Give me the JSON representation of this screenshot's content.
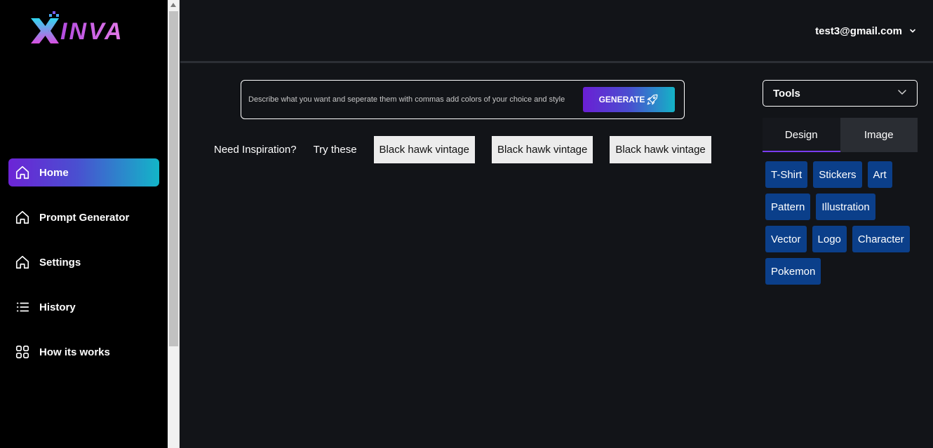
{
  "brand": {
    "logo_text": "INVA",
    "logo_icon": "x-logo-icon"
  },
  "sidebar": {
    "items": [
      {
        "label": "Home",
        "icon": "home-icon",
        "active": true
      },
      {
        "label": "Prompt Generator",
        "icon": "home-icon",
        "active": false
      },
      {
        "label": "Settings",
        "icon": "home-icon",
        "active": false
      },
      {
        "label": "History",
        "icon": "list-icon",
        "active": false
      },
      {
        "label": "How its works",
        "icon": "grid-icon",
        "active": false
      }
    ]
  },
  "header": {
    "user_email": "test3@gmail.com"
  },
  "prompt": {
    "placeholder": "Describe what you want and seperate them with commas add colors of your choice and style",
    "generate_label": "GENERATE"
  },
  "inspiration": {
    "label": "Need Inspiration?",
    "try_label": "Try these",
    "chips": [
      "Black hawk vintage",
      "Black hawk vintage",
      "Black hawk vintage"
    ]
  },
  "panel": {
    "tools_label": "Tools",
    "tabs": [
      {
        "label": "Design",
        "active": true
      },
      {
        "label": "Image",
        "active": false
      }
    ],
    "tags": [
      [
        "T-Shirt",
        "Stickers",
        "Art"
      ],
      [
        "Pattern",
        "Illustration"
      ],
      [
        "Vector",
        "Logo",
        "Character"
      ],
      [
        "Pokemon"
      ]
    ]
  },
  "colors": {
    "background": "#121418",
    "sidebar": "#000000",
    "accent_start": "#6a1fd4",
    "accent_end": "#14b3c6",
    "tag": "#0b3f8a"
  }
}
